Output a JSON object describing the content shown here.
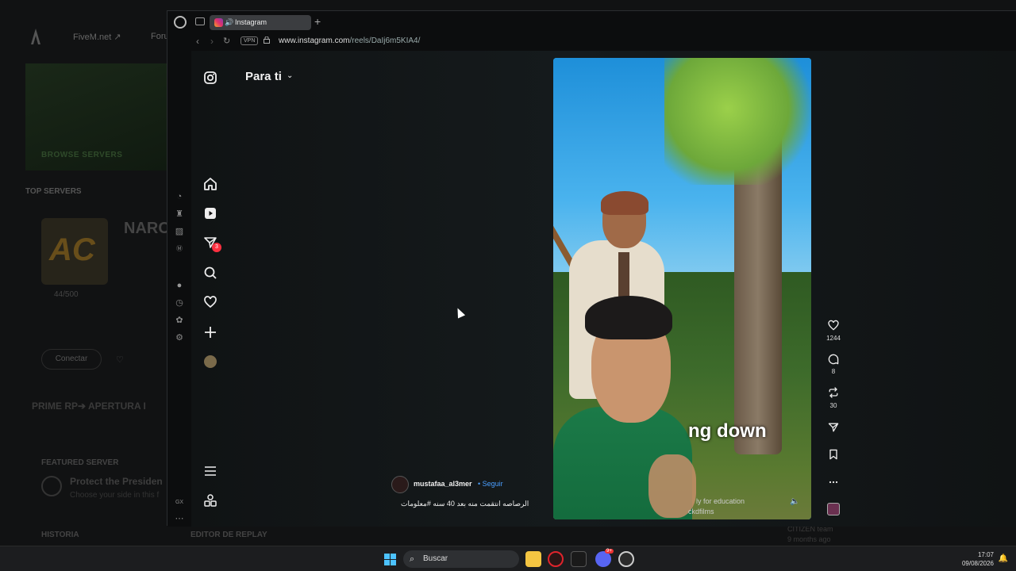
{
  "background_app": {
    "nav": [
      "FiveM.net ↗",
      "Foru"
    ],
    "banner_label": "BROWSE SERVERS",
    "top_servers_label": "TOP SERVERS",
    "server_name": "NARC",
    "server_logo_text": "AC",
    "players": "44/500",
    "connect_label": "Conectar",
    "prime_label": "PRIME RP➔ APERTURA I",
    "featured_label": "FEATURED SERVER",
    "featured_title": "Protect the Presiden",
    "featured_sub": "Choose your side in this f",
    "historia_label": "HISTORIA",
    "editor_label": "EDITOR DE REPLAY",
    "author": "CITIZEN team",
    "ago": "9 months ago"
  },
  "browser": {
    "tab_title": "Instagram",
    "vpn_label": "VPN",
    "url_host": "www.instagram.com",
    "url_path": "/reels/DaIj6m5KIA4/",
    "sidebar_gx_label": "GX"
  },
  "instagram": {
    "feed_title": "Para ti",
    "dm_badge": "3",
    "reel": {
      "subtitle": "ng down",
      "watermark_line1": "ly for education",
      "watermark_line2": "ckdfilms",
      "author": "mustafaa_al3mer",
      "follow_label": "• Seguir",
      "caption": "الرصاصه انتقمت منه بعد 40 سنه #معلومات",
      "likes": "1244",
      "comments": "8",
      "reposts": "30"
    }
  },
  "taskbar": {
    "search_placeholder": "Buscar",
    "time": "17:07",
    "date": "09/08/2026",
    "discord_badge": "9+"
  }
}
